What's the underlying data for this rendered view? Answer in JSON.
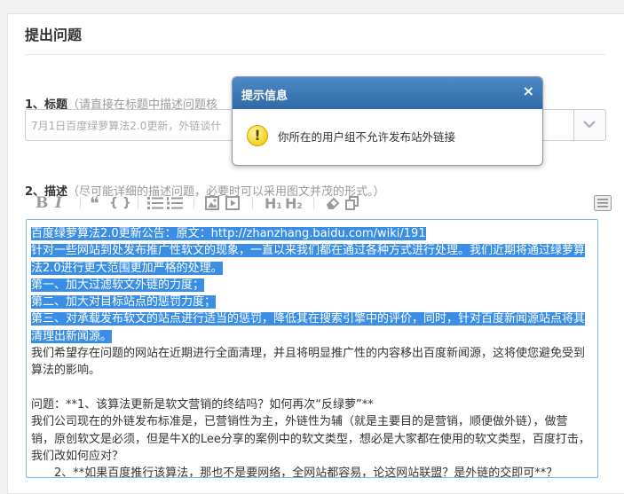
{
  "page": {
    "title": "提出问题"
  },
  "title_field": {
    "label": "1、标题",
    "hint": "（请直接在标题中描述问题核",
    "value": "7月1日百度绿萝算法2.0更新，外链谈什"
  },
  "desc_field": {
    "label": "2、描述",
    "hint": "（尽可能详细的描述问题，必要时可以采用图文并茂的形式。）"
  },
  "toolbar": {
    "bold": "B",
    "italic": "I",
    "quote": "❝",
    "code": "{ }",
    "h1": "H",
    "h1_sub": "1",
    "h2": "H",
    "h2_sub": "2"
  },
  "editor": {
    "selected_lines": [
      "百度绿萝算法2.0更新公告：原文：http://zhanzhang.baidu.com/wiki/191",
      "针对一些网站到处发布推广性软文的现象，一直以来我们都在通过各种方式进行处理。我们近期将通过绿萝算",
      "法2.0进行更大范围更加严格的处理。",
      "第一、加大过滤软文外链的力度；",
      "第二、加大对目标站点的惩罚力度；",
      "第三、对承载发布软文的站点进行适当的惩罚，降低其在搜索引擎中的评价，同时，针对百度新闻源站点将其",
      "清理出新闻源。"
    ],
    "lines": [
      "我们希望存在问题的网站在近期进行全面清理，并且将明显推广性的内容移出百度新闻源，这将使您避免受到",
      "算法的影响。",
      "",
      "问题：**1、该算法更新是软文营销的终结吗？如何再次“反绿萝”**",
      "我们公司现在的外链发布标准是，已营销性为主，外链性为辅（就是主要目的是营销，顺便做外链），做营",
      "销，原创软文是必须，但是牛X的Lee分享的案例中的软文类型，想必是大家都在使用的软文类型，百度打击，",
      "我们改如何应对？",
      "　　2、**如果百度推行该算法，那也不是要网络，全网站都容易，论这网站联盟？是外链的交即可**？"
    ]
  },
  "dialog": {
    "title": "提示信息",
    "close": "×",
    "icon": "!",
    "message": "你所在的用户组不允许发布站外链接"
  }
}
